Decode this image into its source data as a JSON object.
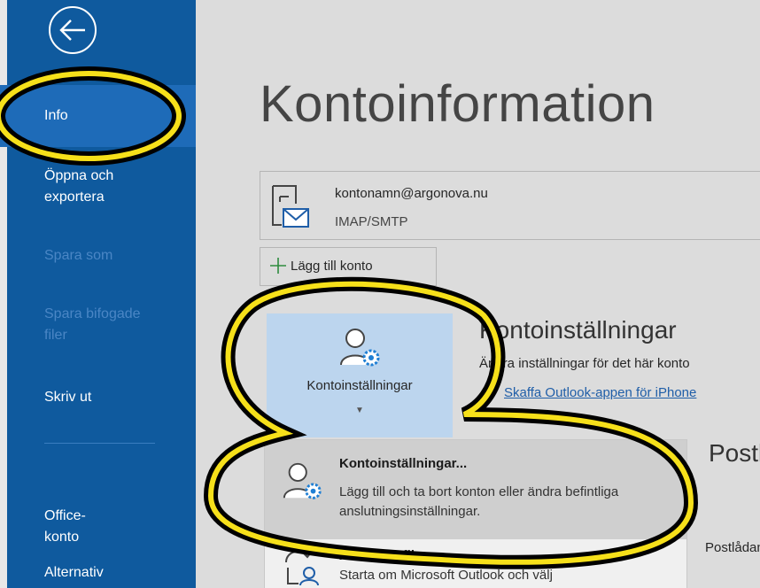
{
  "sidebar": {
    "items": [
      {
        "label": "Info",
        "state": "active"
      },
      {
        "label": "Öppna och exportera",
        "line1": "Öppna och",
        "line2": "exportera",
        "state": "normal"
      },
      {
        "label": "Spara som",
        "state": "disabled"
      },
      {
        "label": "Spara bifogade filer",
        "line1": "Spara bifogade",
        "line2": "filer",
        "state": "disabled"
      },
      {
        "label": "Skriv ut",
        "state": "normal"
      },
      {
        "label": "Office-konto",
        "line1": "Office-",
        "line2": "konto",
        "state": "normal"
      },
      {
        "label": "Alternativ",
        "state": "normal"
      }
    ]
  },
  "main": {
    "title": "Kontoinformation",
    "account": {
      "email": "kontonamn@argonova.nu",
      "type": "IMAP/SMTP"
    },
    "add_account_label": "Lägg till konto",
    "settings_button_label": "Kontoinställningar",
    "section": {
      "title": "Kontoinställningar",
      "description": "Ändra inställningar för det här konto",
      "link": "Skaffa Outlook-appen för iPhone"
    },
    "dropdown": {
      "items": [
        {
          "title": "Kontoinställningar...",
          "description": "Lägg till och ta bort konton eller ändra befintliga anslutningsinställningar."
        },
        {
          "title": "Ändra profil",
          "description": "Starta om Microsoft Outlook och välj"
        }
      ]
    },
    "behind": {
      "title": "Postlåda",
      "description": "Postlådan genom"
    }
  },
  "colors": {
    "sidebar_bg": "#0f5a9e",
    "sidebar_active": "#1e6bb8",
    "highlight_yellow": "#f6e01a",
    "button_selected": "#bcd5ee",
    "link": "#1f5ea8"
  }
}
